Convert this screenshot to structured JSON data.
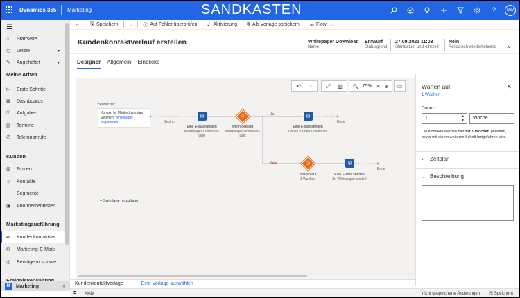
{
  "topbar": {
    "brand": "Dynamics 365",
    "app": "Marketing",
    "environment": "SANDKASTEN",
    "avatar_initials": "DW",
    "icons": [
      "search-icon",
      "task-icon",
      "lightbulb-icon",
      "add-icon",
      "filter-icon",
      "gear-icon",
      "help-icon"
    ]
  },
  "sidebar": {
    "items": [
      {
        "label": "Startseite",
        "icon": "home-icon"
      },
      {
        "label": "Letzte",
        "icon": "clock-icon"
      },
      {
        "label": "Angeheftet",
        "icon": "pin-icon"
      }
    ],
    "sections": [
      {
        "title": "Meine Arbeit",
        "items": [
          "Erste Schritte",
          "Dashboards",
          "Aufgaben",
          "Termine",
          "Telefonanrufe"
        ]
      },
      {
        "title": "Kunden",
        "items": [
          "Firmen",
          "Kontakte",
          "Segmente",
          "Abonnementlisten"
        ]
      },
      {
        "title": "Marketingausführung",
        "items": [
          "Kundenkontaktver...",
          "Marketing-E-Mails",
          "Beiträge in soziale..."
        ]
      },
      {
        "title": "Ereignisverwaltung",
        "items": []
      }
    ],
    "area": {
      "badge": "M",
      "label": "Marketing"
    }
  },
  "commandbar": {
    "back": "back-arrow-icon",
    "save": "Speichern",
    "check": "Auf Fehler überprüfen",
    "activate": "Aktivierung",
    "template": "Als Vorlage speichern",
    "flow": "Flow"
  },
  "header": {
    "title": "Kundenkontaktverlauf erstellen",
    "fields": [
      {
        "value": "Whitepaper Download",
        "label": "Name"
      },
      {
        "value": "Entwurf",
        "label": "Statusgrund"
      },
      {
        "value": "27.09.2021 11:03",
        "label": "Startdatum und -uhrzeit"
      },
      {
        "value": "Nein",
        "label": "Periodisch wiederkehrend"
      }
    ]
  },
  "tabs": [
    {
      "label": "Designer",
      "active": true
    },
    {
      "label": "Allgemein",
      "active": false
    },
    {
      "label": "Einblicke",
      "active": false
    }
  ],
  "toolbar": {
    "zoom": "75%"
  },
  "designer": {
    "start_label": "Startet bei:",
    "start_text": "Kontakt ist Mitglied von das Segment",
    "start_link": "Whitepaper angefordert",
    "begin": "Beginn",
    "end": "Ende",
    "yes": "Ja",
    "no": "Nein",
    "nodes": {
      "email1": {
        "title": "Eine E-Mail senden",
        "sub": "Whitepaper Download-Link"
      },
      "clicked": {
        "title": "wenn geklickt",
        "sub": "Whitepaper Download-Link"
      },
      "email2": {
        "title": "Eine E-Mail senden",
        "sub": "Danke für den Download!"
      },
      "wait": {
        "title": "Warten auf",
        "sub": "1 Wochen"
      },
      "email3": {
        "title": "Eine E-Mail senden",
        "sub": "Ihr Whitepaper wartet!"
      }
    },
    "add_lane": "Swimlane hinzufügen"
  },
  "panel": {
    "title": "Warten auf",
    "subtitle": "1 Wochen",
    "duration_label": "Dauer",
    "duration_value": "1",
    "unit": "Woche",
    "help_pre": "Die Kontakte werden hier ",
    "help_bold": "für 1 Wochen",
    "help_post": " gehalten, bevor mit einem weiteren Schritt fortgefahren wird.",
    "schedule": "Zeitplan",
    "description": "Beschreibung"
  },
  "footer": {
    "template_label": "Kundenkontaktvorlage",
    "template_link": "Eine Vorlage auswählen"
  },
  "status": {
    "state": "Aktiv",
    "unsaved": "nicht gespeicherte Änderungen",
    "save": "Speichern"
  },
  "colors": {
    "accent": "#2266e3",
    "email_node": "#1f5aa8",
    "decision_node": "#e86b1a"
  }
}
